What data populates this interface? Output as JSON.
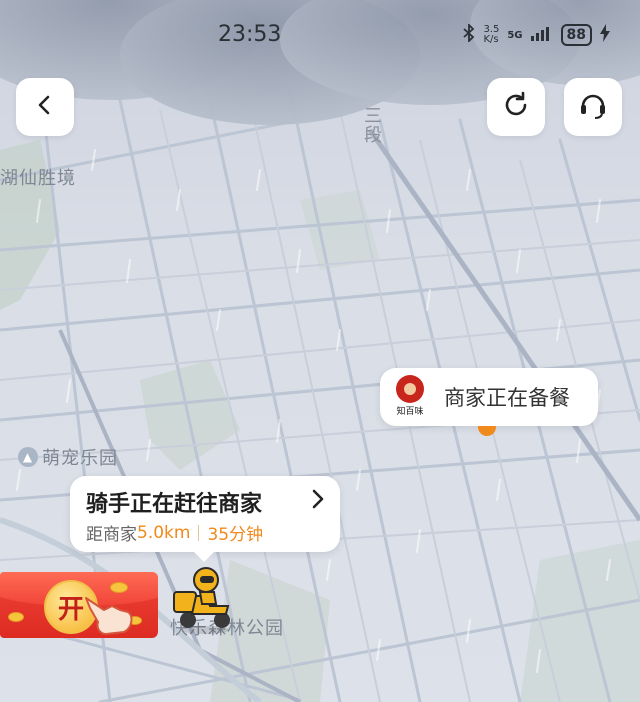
{
  "status_bar": {
    "time": "23:53",
    "net_speed_value": "3.5",
    "net_speed_unit": "K/s",
    "network": "5G",
    "battery": "88"
  },
  "buttons": {
    "back_icon": "chevron-left-icon",
    "refresh_icon": "refresh-icon",
    "support_icon": "headset-icon"
  },
  "map": {
    "labels": {
      "scenic_area": "湖仙胜境",
      "district": "三段",
      "pet_park": "萌宠乐园",
      "park": "快乐森林公园"
    }
  },
  "merchant": {
    "logo_text": "知百味",
    "status": "商家正在备餐"
  },
  "rider": {
    "title": "骑手正在赶往商家",
    "distance_label": "距商家",
    "distance_value": "5.0km",
    "eta": "35分钟"
  },
  "promo": {
    "open_label": "开"
  },
  "colors": {
    "accent": "#f08a1c",
    "map_bg": "#d9dde6",
    "road": "#bcc5d3",
    "red_packet": "#e43a2f"
  }
}
